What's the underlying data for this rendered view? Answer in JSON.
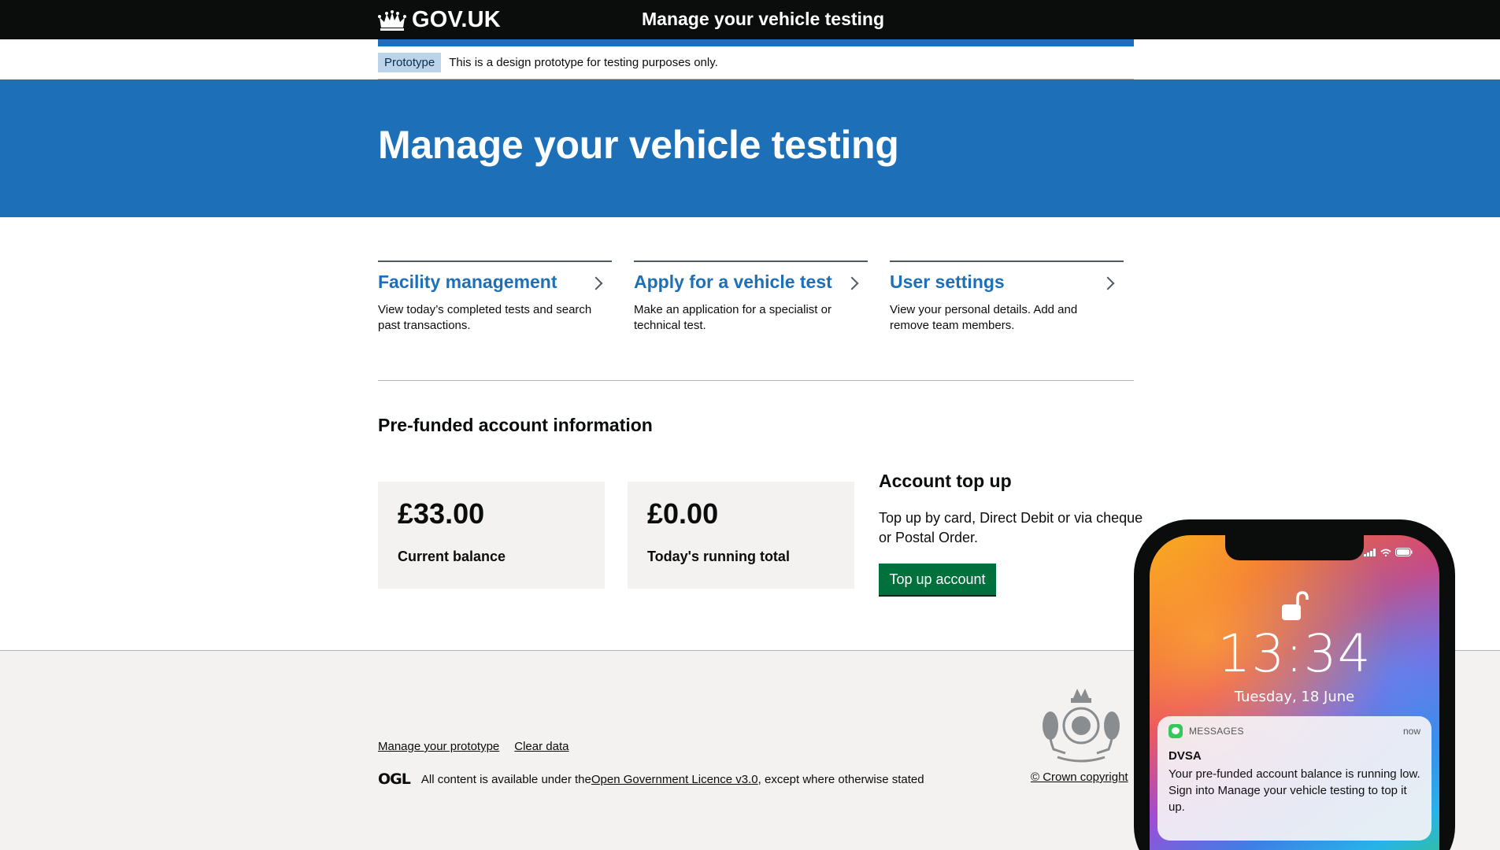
{
  "header": {
    "logo_text": "GOV.UK",
    "service_name": "Manage your vehicle testing"
  },
  "phase_banner": {
    "tag": "Prototype",
    "text": "This is a design prototype for testing purposes only."
  },
  "hero": {
    "title": "Manage your vehicle testing"
  },
  "cards": [
    {
      "title": "Facility management",
      "description": "View today’s completed tests and search past transactions."
    },
    {
      "title": "Apply for a vehicle test",
      "description": "Make an application for a specialist or technical test."
    },
    {
      "title": "User settings",
      "description": "View your personal details. Add and remove team members."
    }
  ],
  "account": {
    "section_title": "Pre-funded account information",
    "stats": [
      {
        "value": "£33.00",
        "label": "Current balance"
      },
      {
        "value": "£0.00",
        "label": "Today's running total"
      }
    ],
    "topup_title": "Account top up",
    "topup_desc": "Top up by card, Direct Debit or via cheque or Postal Order.",
    "topup_button": "Top up account"
  },
  "footer": {
    "links": [
      "Manage your prototype",
      "Clear data"
    ],
    "ogl_logo": "OGL",
    "licence_prefix": "All content is available under the ",
    "licence_link": "Open Government Licence v3.0",
    "licence_suffix": ", except where otherwise stated",
    "copyright": "© Crown copyright"
  },
  "phone": {
    "time": "13:34",
    "date": "Tuesday, 18 June",
    "notification": {
      "app": "MESSAGES",
      "time": "now",
      "sender": "DVSA",
      "body": "Your pre-funded account balance is running low. Sign into Manage your vehicle testing to top it up."
    }
  },
  "colors": {
    "header_bg": "#0b0c0c",
    "brand_blue": "#1d70b8",
    "button_green": "#00703c",
    "panel_grey": "#f3f2f1"
  }
}
